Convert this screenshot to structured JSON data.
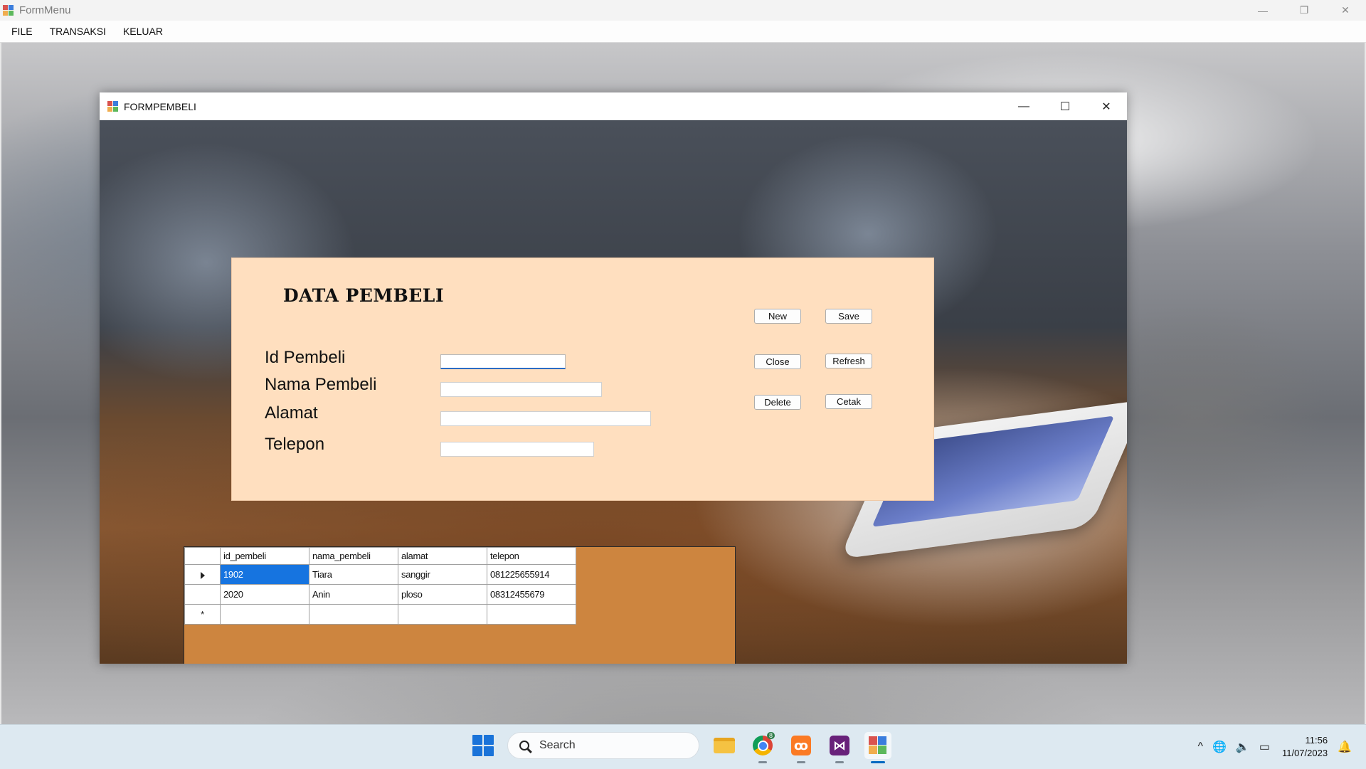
{
  "outer_window": {
    "title": "FormMenu",
    "controls": {
      "minimize": "—",
      "restore": "❐",
      "close": "✕"
    }
  },
  "menu": {
    "items": [
      "FILE",
      "TRANSAKSI",
      "KELUAR"
    ]
  },
  "child_window": {
    "title": "FORMPEMBELI",
    "controls": {
      "minimize": "—",
      "maximize": "☐",
      "close": "✕"
    }
  },
  "panel": {
    "title": "DATA PEMBELI",
    "fields": [
      {
        "label": "Id Pembeli",
        "value": ""
      },
      {
        "label": "Nama Pembeli",
        "value": ""
      },
      {
        "label": "Alamat",
        "value": ""
      },
      {
        "label": "Telepon",
        "value": ""
      }
    ],
    "buttons": {
      "new": "New",
      "save": "Save",
      "close": "Close",
      "refresh": "Refresh",
      "delete": "Delete",
      "cetak": "Cetak"
    },
    "background_color": "#ffdfbf"
  },
  "grid": {
    "columns": [
      "id_pembeli",
      "nama_pembeli",
      "alamat",
      "telepon"
    ],
    "rows": [
      [
        "1902",
        "Tiara",
        "sanggir",
        "081225655914"
      ],
      [
        "2020",
        "Anin",
        "ploso",
        "08312455679"
      ]
    ],
    "new_row_marker": "*",
    "background_color": "#cd853f",
    "selection_color": "#1674e0"
  },
  "taskbar": {
    "search_placeholder": "Search",
    "apps": [
      "file-explorer",
      "chrome",
      "xampp",
      "visual-studio",
      "formmenu-app"
    ],
    "chrome_badge": "8",
    "xampp_glyph": "ꝏ",
    "vs_glyph": "⋈",
    "tray": {
      "chevron": "^",
      "globe": "🌐",
      "volume": "🔈",
      "battery": "▭",
      "bell": "🔔"
    },
    "clock_time": "11:56",
    "clock_date": "11/07/2023"
  }
}
